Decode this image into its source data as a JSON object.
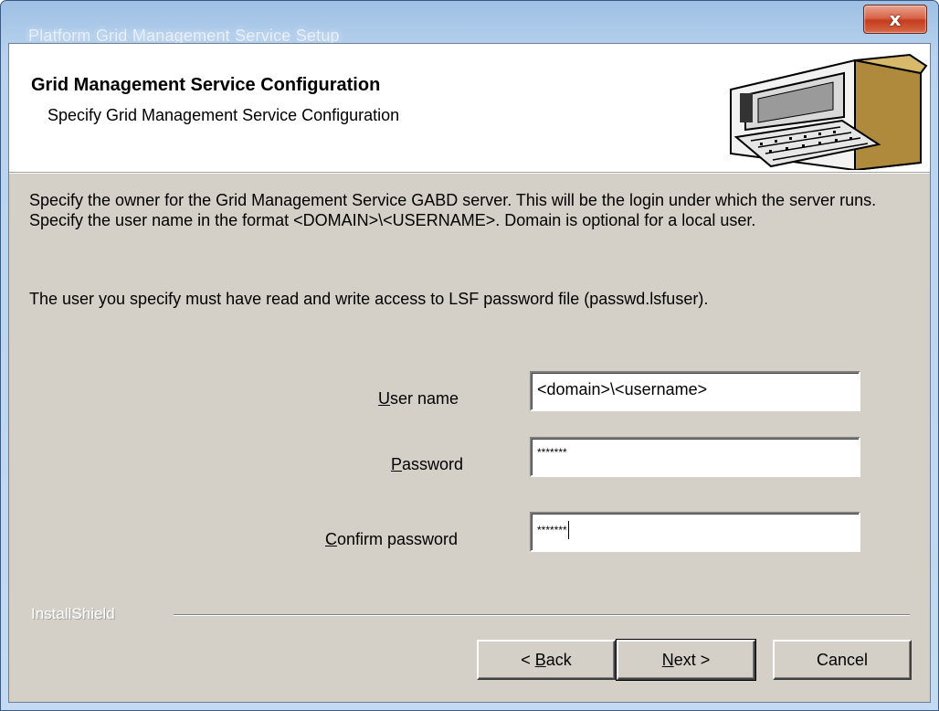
{
  "window": {
    "title": "Platform Grid Management Service Setup",
    "close_glyph": "x"
  },
  "header": {
    "title": "Grid Management Service Configuration",
    "subtitle": "Specify Grid Management Service Configuration",
    "image_icon": "computer-icon"
  },
  "body": {
    "paragraph1": "Specify the owner for the Grid Management Service GABD server.  This will be the login under which the server runs. Specify the user name in the format <DOMAIN>\\<USERNAME>. Domain is optional for a local user.",
    "paragraph2": "The user you specify must have read and write access to LSF password file (passwd.lsfuser)."
  },
  "form": {
    "username": {
      "label_first": "U",
      "label_rest": "ser name",
      "value": "<domain>\\<username>"
    },
    "password": {
      "label_first": "P",
      "label_rest": "assword",
      "value": "*******"
    },
    "confirm": {
      "label_first": "C",
      "label_rest": "onfirm password",
      "value": "*******"
    }
  },
  "footer": {
    "brand": "InstallShield",
    "back": {
      "prefix": "< ",
      "first": "B",
      "rest": "ack"
    },
    "next": {
      "first": "N",
      "rest": "ext >"
    },
    "cancel": "Cancel"
  }
}
